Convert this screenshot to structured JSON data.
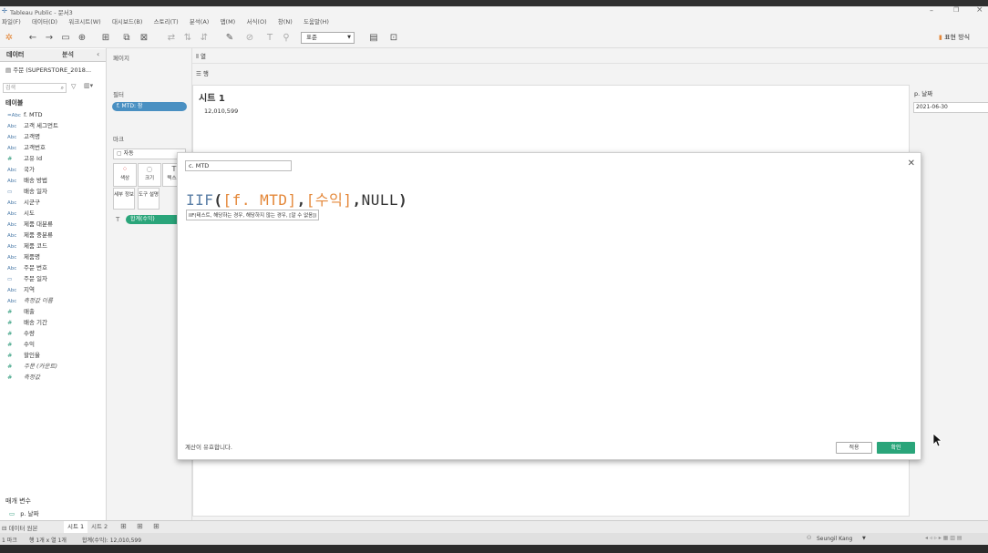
{
  "window": {
    "title": "Tableau Public - 문서3"
  },
  "menu": [
    "파일(F)",
    "데이터(D)",
    "워크시트(W)",
    "대시보드(B)",
    "스토리(T)",
    "분석(A)",
    "맵(M)",
    "서식(O)",
    "창(N)",
    "도움말(H)"
  ],
  "toolbar": {
    "fit_select": "표준",
    "show_me": "표현 방식"
  },
  "left": {
    "tab_data": "데이터",
    "tab_analysis": "분석",
    "datasource": "주문 (SUPERSTORE_2018...",
    "search_placeholder": "검색",
    "tables_header": "테이블",
    "fields": [
      {
        "icon": "=Abc",
        "label": "f. MTD"
      },
      {
        "icon": "Abc",
        "label": "고객 세그먼트"
      },
      {
        "icon": "Abc",
        "label": "고객명"
      },
      {
        "icon": "Abc",
        "label": "고객번호"
      },
      {
        "icon": "#",
        "label": "고유 Id"
      },
      {
        "icon": "Abc",
        "label": "국가"
      },
      {
        "icon": "Abc",
        "label": "배송 방법"
      },
      {
        "icon": "cal",
        "label": "배송 일자"
      },
      {
        "icon": "Abc",
        "label": "시군구"
      },
      {
        "icon": "Abc",
        "label": "시도"
      },
      {
        "icon": "Abc",
        "label": "제품 대분류"
      },
      {
        "icon": "Abc",
        "label": "제품 중분류"
      },
      {
        "icon": "Abc",
        "label": "제품 코드"
      },
      {
        "icon": "Abc",
        "label": "제품명"
      },
      {
        "icon": "Abc",
        "label": "주문 번호"
      },
      {
        "icon": "cal",
        "label": "주문 일자"
      },
      {
        "icon": "Abc",
        "label": "지역"
      },
      {
        "icon": "Abc",
        "label": "측정값 이름"
      },
      {
        "icon": "#",
        "label": "매출"
      },
      {
        "icon": "#",
        "label": "배송 기간"
      },
      {
        "icon": "#",
        "label": "수량"
      },
      {
        "icon": "#",
        "label": "수익"
      },
      {
        "icon": "#",
        "label": "할인율"
      },
      {
        "icon": "#",
        "label": "주문 (카운트)"
      },
      {
        "icon": "#",
        "label": "측정값"
      }
    ],
    "params_header": "매개 변수",
    "param": "p. 날짜"
  },
  "shelves": {
    "pages": "페이지",
    "filters": "필터",
    "filter_pill": "f. MTD: 참",
    "marks": "마크",
    "marks_type": "자동",
    "color": "색상",
    "size": "크기",
    "text": "텍스트",
    "detail": "세부 정보",
    "tooltip": "도구 설명",
    "marks_pill": "합계(수익)",
    "columns": "열",
    "rows": "행"
  },
  "view": {
    "sheet_title": "시트 1",
    "value": "12,010,599"
  },
  "param_card": {
    "title": "p. 날짜",
    "value": "2021-06-30"
  },
  "dialog": {
    "calc_name": "c. MTD",
    "formula": {
      "kw": "IIF",
      "open": "(",
      "field1": "[f. MTD]",
      "comma1": ",",
      "field2": "[수익]",
      "comma2": ",",
      "null": "NULL",
      "close": ")"
    },
    "hint": "IIF(테스트, 해당하는 경우, 해당하지 않는 경우, [알 수 없음])",
    "status": "계산이 유효합니다.",
    "apply": "적용",
    "ok": "확인"
  },
  "bottom_tabs": {
    "datasource": "데이터 원본",
    "sheet1": "시트 1",
    "sheet2": "시트 2"
  },
  "status": {
    "marks": "1 마크",
    "rowcol": "행 1개 x 열 1개",
    "sum": "합계(수익): 12,010,599",
    "user": "Seungil Kang"
  }
}
